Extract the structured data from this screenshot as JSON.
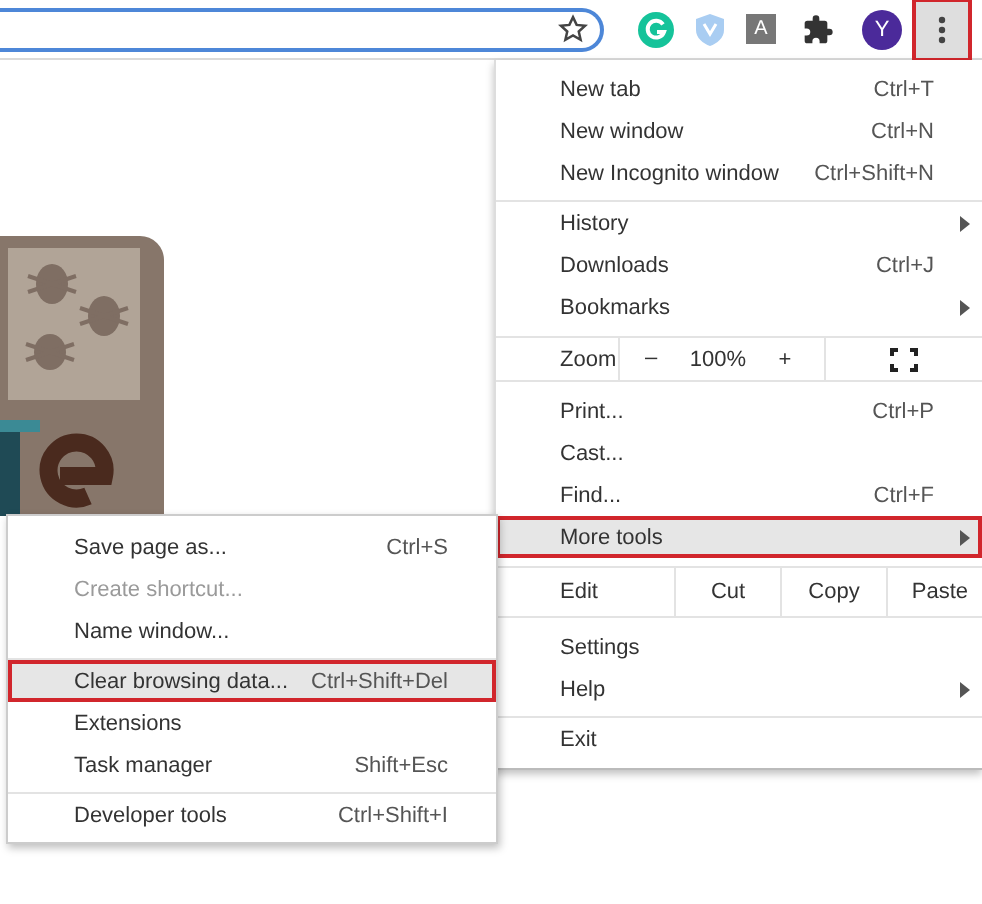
{
  "toolbar": {
    "extensions": [
      {
        "kind": "grammar"
      },
      {
        "kind": "shield"
      },
      {
        "kind": "letter",
        "text": "A"
      },
      {
        "kind": "puzzle"
      }
    ],
    "avatar": "Y",
    "menu_button": {
      "highlighted": true
    }
  },
  "menu": [
    {
      "kind": "item",
      "label": "New tab",
      "shortcut": "Ctrl+T",
      "submenu": false,
      "highlighted": false
    },
    {
      "kind": "item",
      "label": "New window",
      "shortcut": "Ctrl+N",
      "submenu": false,
      "highlighted": false
    },
    {
      "kind": "item",
      "label": "New Incognito window",
      "shortcut": "Ctrl+Shift+N",
      "submenu": false,
      "highlighted": false
    },
    {
      "kind": "separator"
    },
    {
      "kind": "item",
      "label": "History",
      "submenu": true,
      "highlighted": false
    },
    {
      "kind": "item",
      "label": "Downloads",
      "shortcut": "Ctrl+J",
      "submenu": false,
      "highlighted": false
    },
    {
      "kind": "item",
      "label": "Bookmarks",
      "submenu": true,
      "highlighted": false
    },
    {
      "kind": "zoom",
      "label": "Zoom",
      "minus": "–",
      "value": "100%",
      "plus": "+"
    },
    {
      "kind": "item",
      "label": "Print...",
      "shortcut": "Ctrl+P",
      "submenu": false,
      "highlighted": false
    },
    {
      "kind": "item",
      "label": "Cast...",
      "submenu": false,
      "highlighted": false
    },
    {
      "kind": "item",
      "label": "Find...",
      "shortcut": "Ctrl+F",
      "submenu": false,
      "highlighted": false
    },
    {
      "kind": "item",
      "label": "More tools",
      "submenu": true,
      "highlighted": true
    },
    {
      "kind": "edit",
      "label": "Edit",
      "actions": [
        "Cut",
        "Copy",
        "Paste"
      ]
    },
    {
      "kind": "item",
      "label": "Settings",
      "submenu": false,
      "highlighted": false
    },
    {
      "kind": "item",
      "label": "Help",
      "submenu": true,
      "highlighted": false
    },
    {
      "kind": "separator"
    },
    {
      "kind": "item",
      "label": "Exit",
      "submenu": false,
      "highlighted": false
    }
  ],
  "submenu": [
    {
      "kind": "item",
      "label": "Save page as...",
      "shortcut": "Ctrl+S",
      "disabled": false,
      "highlighted": false
    },
    {
      "kind": "item",
      "label": "Create shortcut...",
      "disabled": true,
      "highlighted": false
    },
    {
      "kind": "item",
      "label": "Name window...",
      "disabled": false,
      "highlighted": false
    },
    {
      "kind": "separator"
    },
    {
      "kind": "item",
      "label": "Clear browsing data...",
      "shortcut": "Ctrl+Shift+Del",
      "disabled": false,
      "highlighted": true
    },
    {
      "kind": "item",
      "label": "Extensions",
      "disabled": false,
      "highlighted": false
    },
    {
      "kind": "item",
      "label": "Task manager",
      "shortcut": "Shift+Esc",
      "disabled": false,
      "highlighted": false
    },
    {
      "kind": "separator"
    },
    {
      "kind": "item",
      "label": "Developer tools",
      "shortcut": "Ctrl+Shift+I",
      "disabled": false,
      "highlighted": false
    }
  ]
}
